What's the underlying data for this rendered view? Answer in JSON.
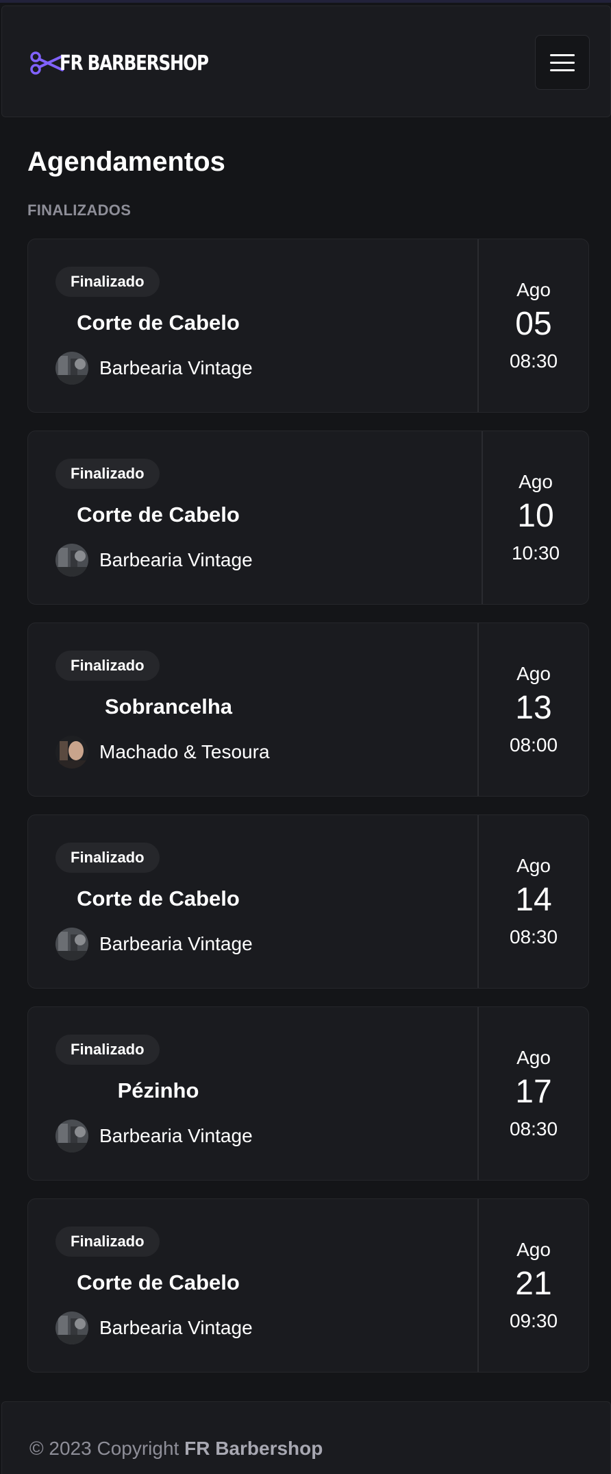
{
  "header": {
    "logo_text": "FR BARBERSHOP",
    "logo_icon": "scissors-icon",
    "menu_icon": "hamburger-menu-icon",
    "accent_color": "#8162ff"
  },
  "page": {
    "title": "Agendamentos",
    "section_label": "FINALIZADOS"
  },
  "bookings": [
    {
      "status": "Finalizado",
      "service": "Corte de Cabelo",
      "shop": "Barbearia Vintage",
      "month": "Ago",
      "day": "05",
      "time": "08:30"
    },
    {
      "status": "Finalizado",
      "service": "Corte de Cabelo",
      "shop": "Barbearia Vintage",
      "month": "Ago",
      "day": "10",
      "time": "10:30"
    },
    {
      "status": "Finalizado",
      "service": "Sobrancelha",
      "shop": "Machado & Tesoura",
      "month": "Ago",
      "day": "13",
      "time": "08:00"
    },
    {
      "status": "Finalizado",
      "service": "Corte de Cabelo",
      "shop": "Barbearia Vintage",
      "month": "Ago",
      "day": "14",
      "time": "08:30"
    },
    {
      "status": "Finalizado",
      "service": "Pézinho",
      "shop": "Barbearia Vintage",
      "month": "Ago",
      "day": "17",
      "time": "08:30"
    },
    {
      "status": "Finalizado",
      "service": "Corte de Cabelo",
      "shop": "Barbearia Vintage",
      "month": "Ago",
      "day": "21",
      "time": "09:30"
    }
  ],
  "footer": {
    "copyright_prefix": "© 2023 Copyright",
    "brand": "FR Barbershop"
  }
}
